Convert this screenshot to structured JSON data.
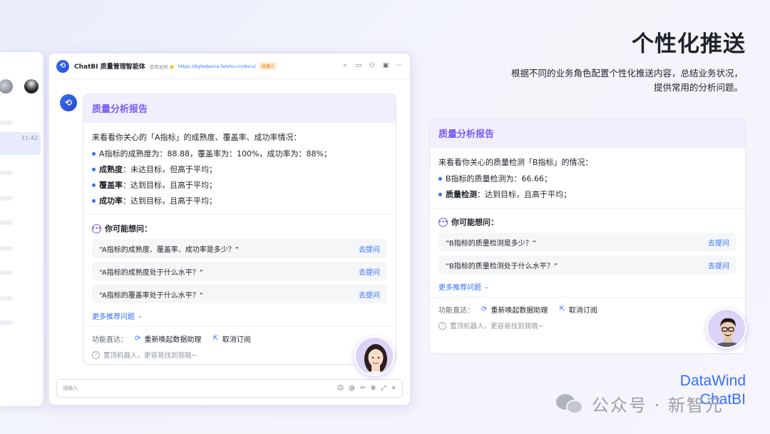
{
  "slide": {
    "title": "个性化推送",
    "description_line1": "根据不同的业务角色配置个性化推送内容，总结业务状况，",
    "description_line2": "提供常用的分析问题。",
    "brand_line1": "DataWind",
    "brand_line2": "ChatBI",
    "watermark": "公众号 · 新智元"
  },
  "sidebar": {
    "time": "11:42"
  },
  "chat": {
    "title": "ChatBI 质量管理智能体",
    "desc": "使用说明 👉",
    "link": "https://bytedance.feishu.cn/docx/",
    "tag": "机器人",
    "input_placeholder": "请输入"
  },
  "card_left": {
    "title": "质量分析报告",
    "intro": "来看看你关心的「A指标」的成熟度、覆盖率、成功率情况：",
    "bullets": [
      {
        "bold": "",
        "text": "A指标的成熟度为：88.88，覆盖率为：100%，成功率为：88%；"
      },
      {
        "bold": "成熟度",
        "text": "：未达目标，但高于平均；"
      },
      {
        "bold": "覆盖率",
        "text": "：达到目标，且高于平均；"
      },
      {
        "bold": "成功率",
        "text": "：达到目标，且高于平均；"
      }
    ],
    "maybe_title": "你可能想问：",
    "questions": [
      {
        "q": "“A指标的成熟度、覆盖率、成功率是多少？”",
        "action": "去提问"
      },
      {
        "q": "“A指标的成熟度处于什么水平？”",
        "action": "去提问"
      },
      {
        "q": "“A指标的覆盖率处于什么水平？”",
        "action": "去提问"
      }
    ],
    "more": "更多推荐问题",
    "func_label": "功能直达：",
    "func_1": "重新唤起数据助理",
    "func_2": "取消订阅",
    "tip": "置顶机器人，更容易找到我哦~"
  },
  "card_right": {
    "title": "质量分析报告",
    "intro": "来看看你关心的质量检测「B指标」的情况：",
    "bullets": [
      {
        "bold": "",
        "text": "B指标的质量检测为：66.66；"
      },
      {
        "bold": "质量检测",
        "text": "：达到目标，且高于平均；"
      }
    ],
    "maybe_title": "你可能想问：",
    "questions": [
      {
        "q": "“B指标的质量检测是多少？”",
        "action": "去提问"
      },
      {
        "q": "“B指标的质量检测处于什么水平？”",
        "action": "去提问"
      }
    ],
    "more": "更多推荐问题",
    "func_label": "功能直达：",
    "func_1": "重新唤起数据助理",
    "func_2": "取消订阅",
    "tip": "置顶机器人，更容易找到我哦~"
  },
  "colors": {
    "accent": "#3370ff",
    "card_title": "#7a5af5",
    "card_header_bg": "#f1effd"
  }
}
